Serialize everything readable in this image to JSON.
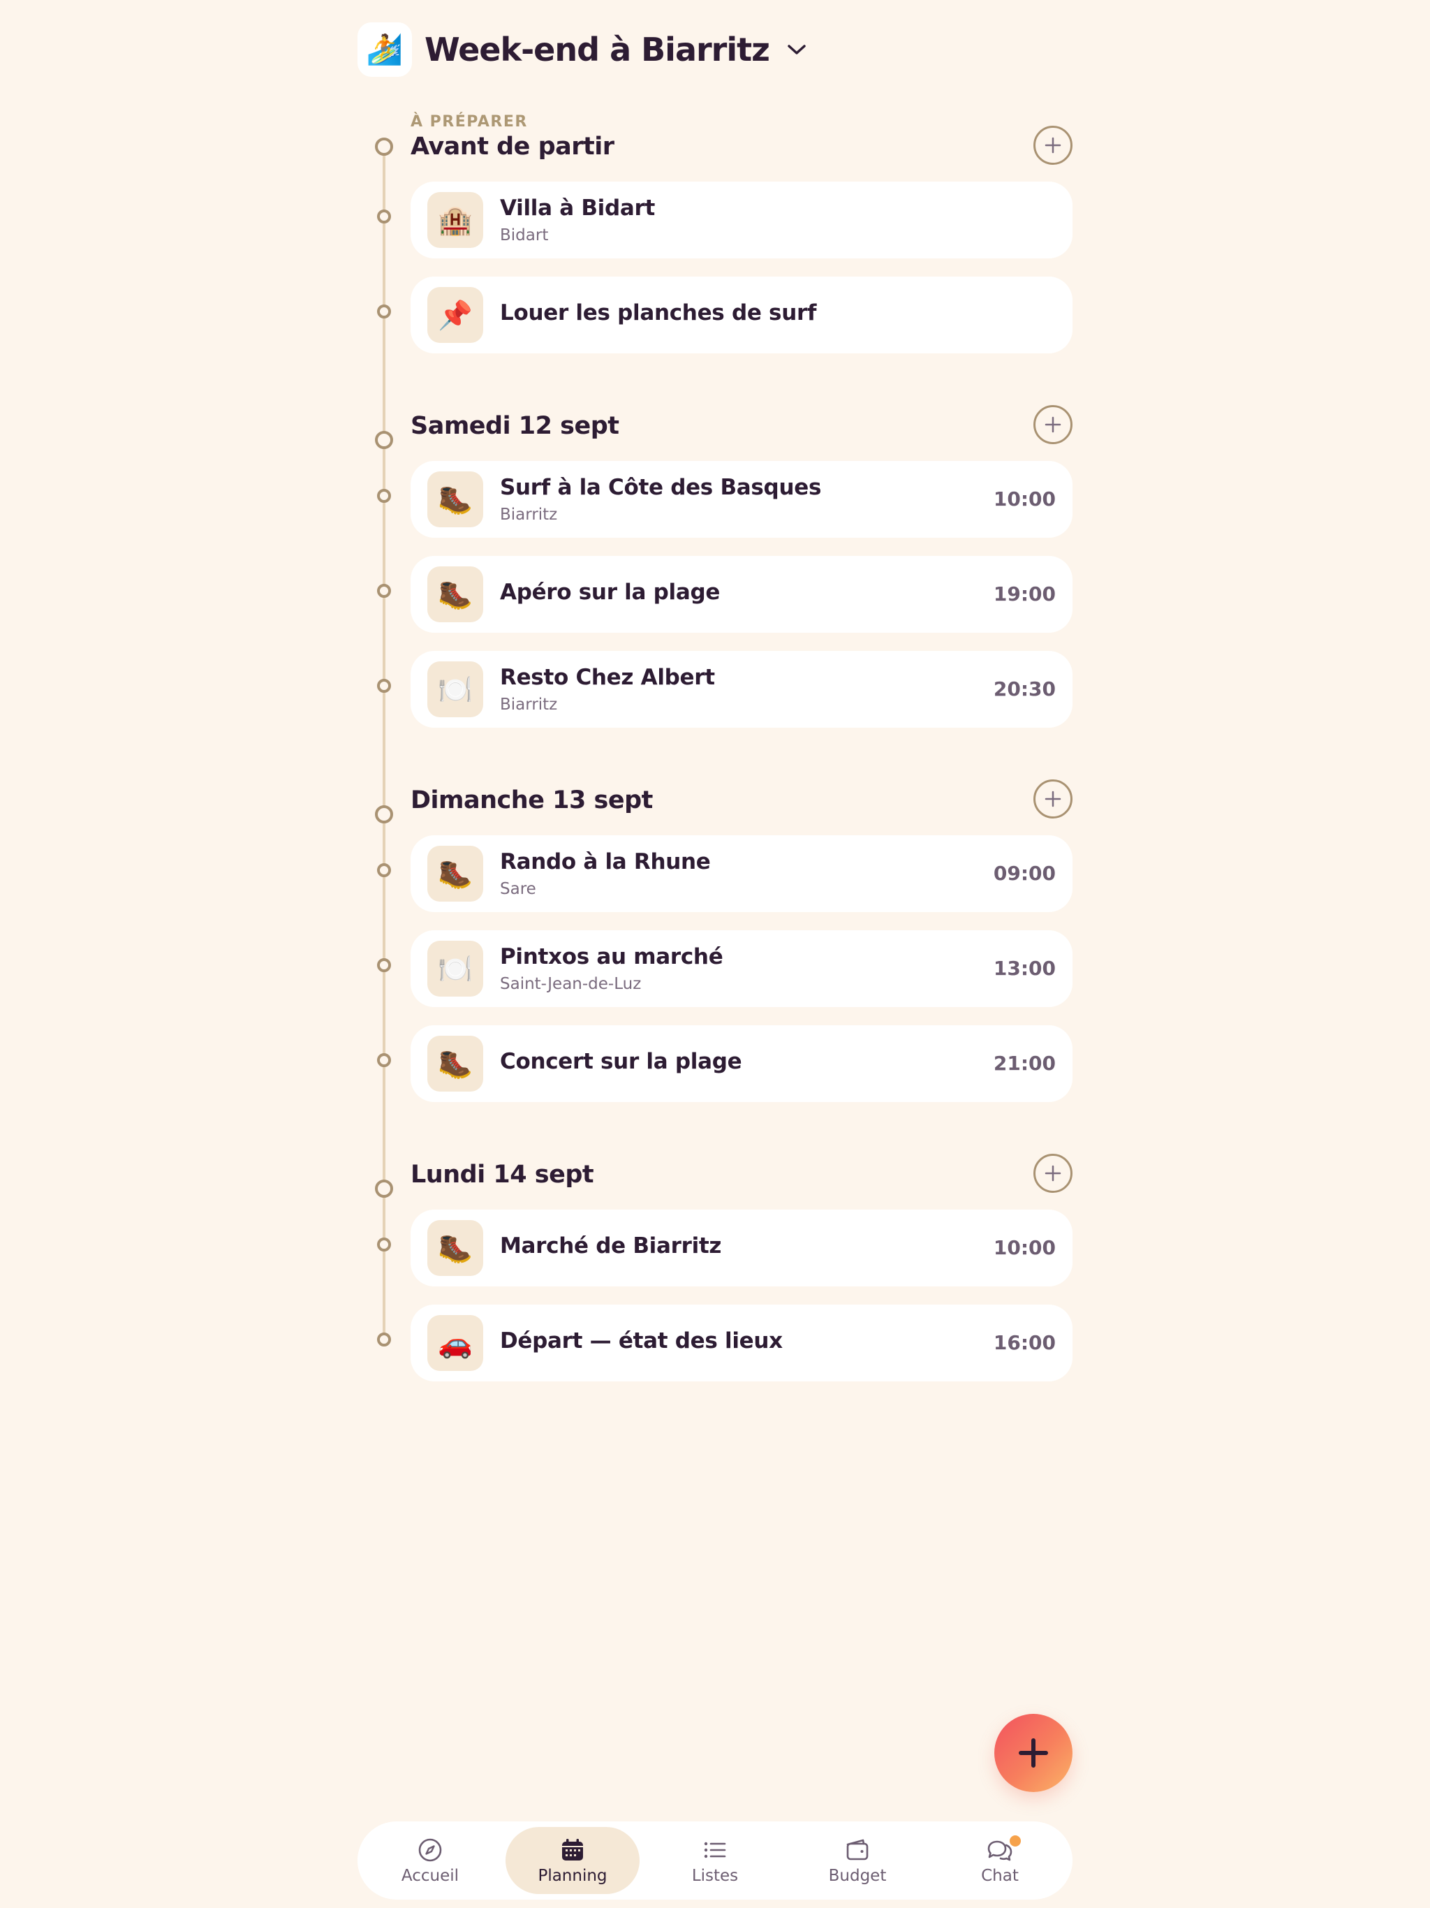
{
  "header": {
    "trip_icon": "🏄",
    "trip_icon_name": "surfer-emoji-icon",
    "title": "Week-end à Biarritz",
    "dropdown_icon": "chevron-down-icon"
  },
  "sections": [
    {
      "kicker": "À PRÉPARER",
      "title": "Avant de partir",
      "items": [
        {
          "emoji": "🏨",
          "icon_name": "hotel-icon",
          "title": "Villa à Bidart",
          "subtitle": "Bidart",
          "time": ""
        },
        {
          "emoji": "📌",
          "icon_name": "pushpin-icon",
          "title": "Louer les planches de surf",
          "subtitle": "",
          "time": ""
        }
      ]
    },
    {
      "kicker": "",
      "title": "Samedi 12 sept",
      "items": [
        {
          "emoji": "🥾",
          "icon_name": "hiking-boot-icon",
          "title": "Surf à la Côte des Basques",
          "subtitle": "Biarritz",
          "time": "10:00"
        },
        {
          "emoji": "🥾",
          "icon_name": "hiking-boot-icon",
          "title": "Apéro sur la plage",
          "subtitle": "",
          "time": "19:00"
        },
        {
          "emoji": "🍽️",
          "icon_name": "plate-cutlery-icon",
          "title": "Resto Chez Albert",
          "subtitle": "Biarritz",
          "time": "20:30"
        }
      ]
    },
    {
      "kicker": "",
      "title": "Dimanche 13 sept",
      "items": [
        {
          "emoji": "🥾",
          "icon_name": "hiking-boot-icon",
          "title": "Rando à la Rhune",
          "subtitle": "Sare",
          "time": "09:00"
        },
        {
          "emoji": "🍽️",
          "icon_name": "plate-cutlery-icon",
          "title": "Pintxos au marché",
          "subtitle": "Saint-Jean-de-Luz",
          "time": "13:00"
        },
        {
          "emoji": "🥾",
          "icon_name": "hiking-boot-icon",
          "title": "Concert sur la plage",
          "subtitle": "",
          "time": "21:00"
        }
      ]
    },
    {
      "kicker": "",
      "title": "Lundi 14 sept",
      "items": [
        {
          "emoji": "🥾",
          "icon_name": "hiking-boot-icon",
          "title": "Marché de Biarritz",
          "subtitle": "",
          "time": "10:00"
        },
        {
          "emoji": "🚗",
          "icon_name": "car-icon",
          "title": "Départ — état des lieux",
          "subtitle": "",
          "time": "16:00"
        }
      ]
    }
  ],
  "nav": {
    "items": [
      {
        "label": "Accueil",
        "icon": "compass-icon",
        "active": false,
        "badge": false
      },
      {
        "label": "Planning",
        "icon": "calendar-icon",
        "active": true,
        "badge": false
      },
      {
        "label": "Listes",
        "icon": "list-icon",
        "active": false,
        "badge": false
      },
      {
        "label": "Budget",
        "icon": "wallet-icon",
        "active": false,
        "badge": false
      },
      {
        "label": "Chat",
        "icon": "chat-bubbles-icon",
        "active": false,
        "badge": true
      }
    ]
  },
  "fab": {
    "icon": "plus-icon"
  },
  "colors": {
    "background": "#fdf5ec",
    "card": "#ffffff",
    "text_primary": "#2d1c33",
    "text_muted": "#7a6b7e",
    "timeline": "#a99272",
    "accent_gradient_start": "#f2525f",
    "accent_gradient_end": "#fbb467",
    "badge": "#f6a24b"
  }
}
